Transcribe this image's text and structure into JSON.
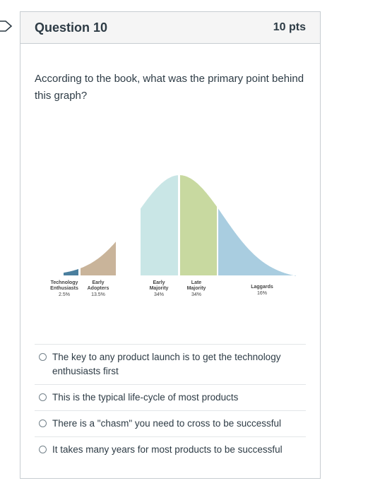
{
  "question": {
    "title": "Question 10",
    "points": "10 pts",
    "text": "According to the book, what was the primary point behind this graph?"
  },
  "chart_data": {
    "type": "area",
    "segments": [
      {
        "name": "Technology Enthusiasts",
        "label_lines": [
          "Technology",
          "Enthusiasts"
        ],
        "value": "2.5%",
        "color": "#4a7f9e"
      },
      {
        "name": "Early Adopters",
        "label_lines": [
          "Early",
          "Adopters"
        ],
        "value": "13.5%",
        "color": "#c9b49a"
      },
      {
        "name": "Early Majority",
        "label_lines": [
          "Early",
          "Majority"
        ],
        "value": "34%",
        "color": "#c9e6e6"
      },
      {
        "name": "Late Majority",
        "label_lines": [
          "Late",
          "Majority"
        ],
        "value": "34%",
        "color": "#c8d9a0"
      },
      {
        "name": "Laggards",
        "label_lines": [
          "Laggards"
        ],
        "value": "16%",
        "color": "#a9cde0"
      }
    ]
  },
  "answers": [
    {
      "label": "The key to any product launch is to get the technology enthusiasts first"
    },
    {
      "label": "This is the typical life-cycle of most products"
    },
    {
      "label": "There is a \"chasm\" you need to cross to be successful"
    },
    {
      "label": "It takes many years for most products to be successful"
    }
  ]
}
